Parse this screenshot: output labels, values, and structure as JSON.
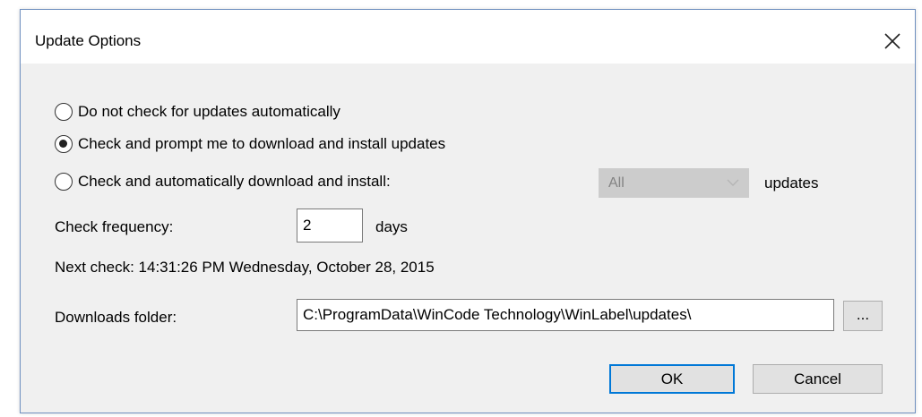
{
  "dialog": {
    "title": "Update Options"
  },
  "options": {
    "radio_no_check": "Do not check for updates automatically",
    "radio_prompt": "Check and prompt me to download and install updates",
    "radio_auto": "Check and automatically download and install:",
    "selected": "radio_prompt"
  },
  "auto_scope": {
    "selected": "All",
    "suffix": "updates"
  },
  "frequency": {
    "label": "Check frequency:",
    "value": "2",
    "unit": "days"
  },
  "next_check": {
    "text": "Next check: 14:31:26 PM Wednesday, October 28, 2015"
  },
  "downloads": {
    "label": "Downloads folder:",
    "path": "C:\\ProgramData\\WinCode Technology\\WinLabel\\updates\\",
    "browse_label": "..."
  },
  "buttons": {
    "ok": "OK",
    "cancel": "Cancel"
  },
  "colors": {
    "dialog_bg": "#f0f0f0",
    "default_button_border": "#0078d7",
    "disabled_select_bg": "#cccccc"
  },
  "icons": {
    "close": "close-icon",
    "dropdown": "chevron-down-icon"
  }
}
